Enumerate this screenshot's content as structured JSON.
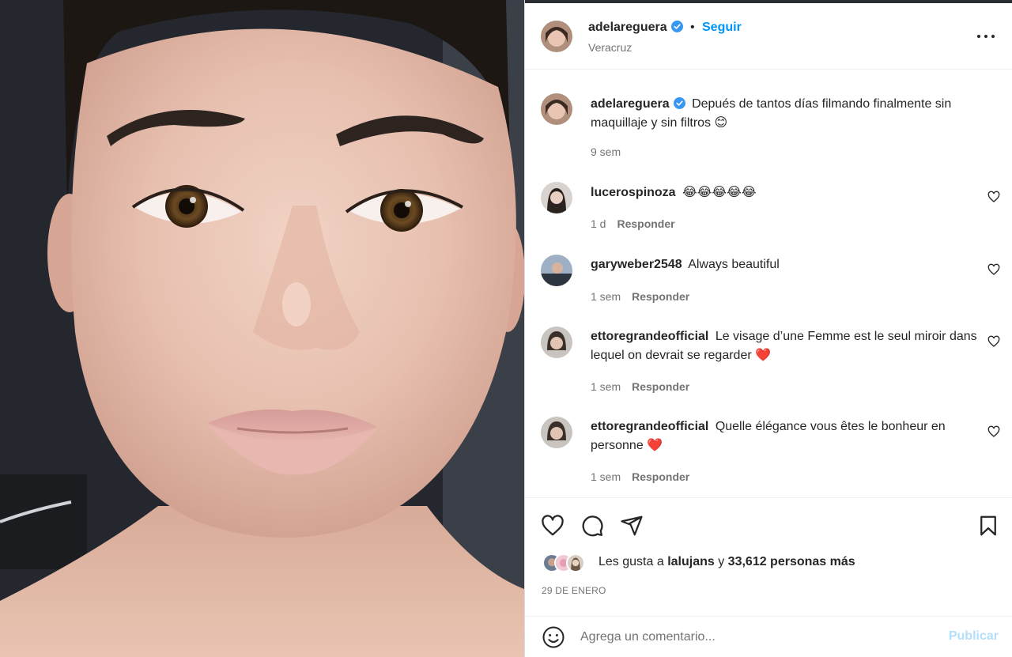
{
  "post": {
    "username": "adelareguera",
    "separator": "•",
    "follow_label": "Seguir",
    "location": "Veracruz"
  },
  "caption": {
    "username": "adelareguera",
    "text": "Depués de tantos días filmando finalmente sin maquillaje y sin filtros",
    "emoji": "😊",
    "time": "9 sem"
  },
  "comments": [
    {
      "username": "lucerospinoza",
      "text": "",
      "emoji": "😂😂😂😂😂",
      "time": "1 d",
      "reply": "Responder"
    },
    {
      "username": "garyweber2548",
      "text": "Always beautiful",
      "emoji": "",
      "time": "1 sem",
      "reply": "Responder"
    },
    {
      "username": "ettoregrandeofficial",
      "text": "Le visage d’une Femme est le seul miroir dans lequel on devrait se regarder",
      "emoji": "❤️",
      "time": "1 sem",
      "reply": "Responder"
    },
    {
      "username": "ettoregrandeofficial",
      "text": "Quelle élégance vous êtes le bonheur en personne",
      "emoji": "❤️",
      "time": "1 sem",
      "reply": "Responder"
    }
  ],
  "likes": {
    "prefix": "Les gusta a",
    "user": "lalujans",
    "connector": "y",
    "others": "33,612 personas más"
  },
  "date": "29 DE ENERO",
  "add_comment": {
    "placeholder": "Agrega un comentario...",
    "publish_label": "Publicar"
  },
  "icons": {
    "verified": "verified-badge-icon",
    "more": "more-options-icon",
    "like": "heart-icon",
    "comment": "comment-bubble-icon",
    "share": "paper-plane-icon",
    "save": "bookmark-icon",
    "emoji": "smiley-icon"
  },
  "colors": {
    "accent": "#0095f6",
    "accent_disabled": "#b2dffc",
    "text": "#262626",
    "secondary_text": "#737373",
    "heart_emoji": "#e0245e"
  }
}
